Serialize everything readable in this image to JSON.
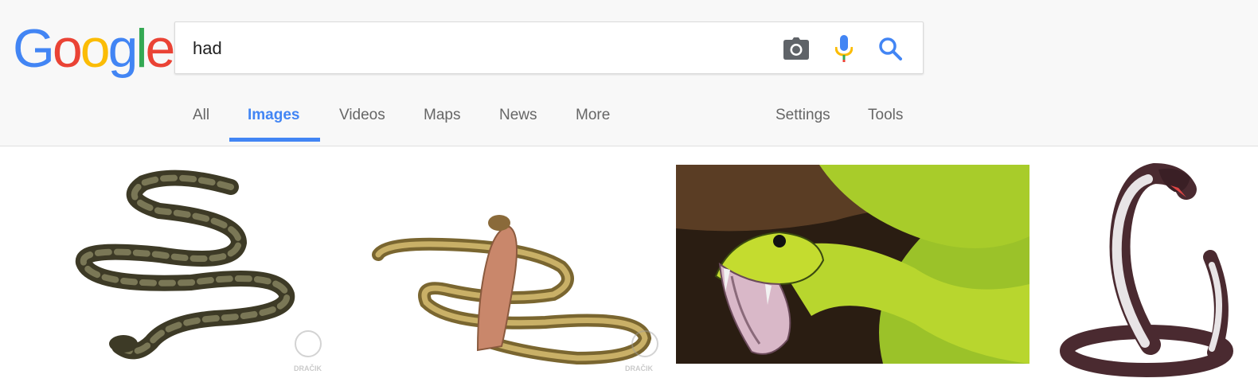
{
  "logo": {
    "letters": [
      "G",
      "o",
      "o",
      "g",
      "l",
      "e"
    ],
    "colors": [
      "#4285f4",
      "#ea4335",
      "#fbbc05",
      "#4285f4",
      "#34a853",
      "#ea4335"
    ]
  },
  "search": {
    "query": "had",
    "camera_icon": "camera-icon",
    "mic_icon": "microphone-icon",
    "search_icon": "search-icon"
  },
  "tabs": [
    {
      "label": "All",
      "active": false
    },
    {
      "label": "Images",
      "active": true
    },
    {
      "label": "Videos",
      "active": false
    },
    {
      "label": "Maps",
      "active": false
    },
    {
      "label": "News",
      "active": false
    },
    {
      "label": "More",
      "active": false
    }
  ],
  "tools": {
    "settings_label": "Settings",
    "tools_label": "Tools"
  },
  "colors": {
    "accent": "#4285f4",
    "tab_text": "#666666",
    "header_bg": "#f8f8f8"
  },
  "results": {
    "watermark": "DRAČIK"
  }
}
